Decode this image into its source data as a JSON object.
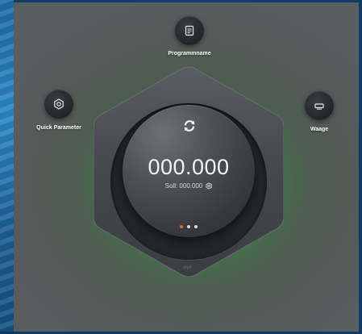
{
  "buttons": {
    "program": {
      "label": "Programmname",
      "icon": "document-icon"
    },
    "quick": {
      "label": "Quick Parameter",
      "icon": "gear-icon"
    },
    "scale": {
      "label": "Waage",
      "icon": "scale-icon"
    }
  },
  "dial": {
    "value": "000.000",
    "target_label": "Soll: 000.000",
    "refresh_icon": "refresh-icon",
    "target_icon": "gear-icon"
  },
  "pager": {
    "count": 3,
    "active_index": 0,
    "active_color": "#e36a2a",
    "inactive_color": "#d9dbdd"
  },
  "brand": {
    "text": "digit"
  },
  "colors": {
    "green_glow": "#4f9a52",
    "dark_button": "#222528",
    "frame_blue": "#1e6aa6"
  }
}
